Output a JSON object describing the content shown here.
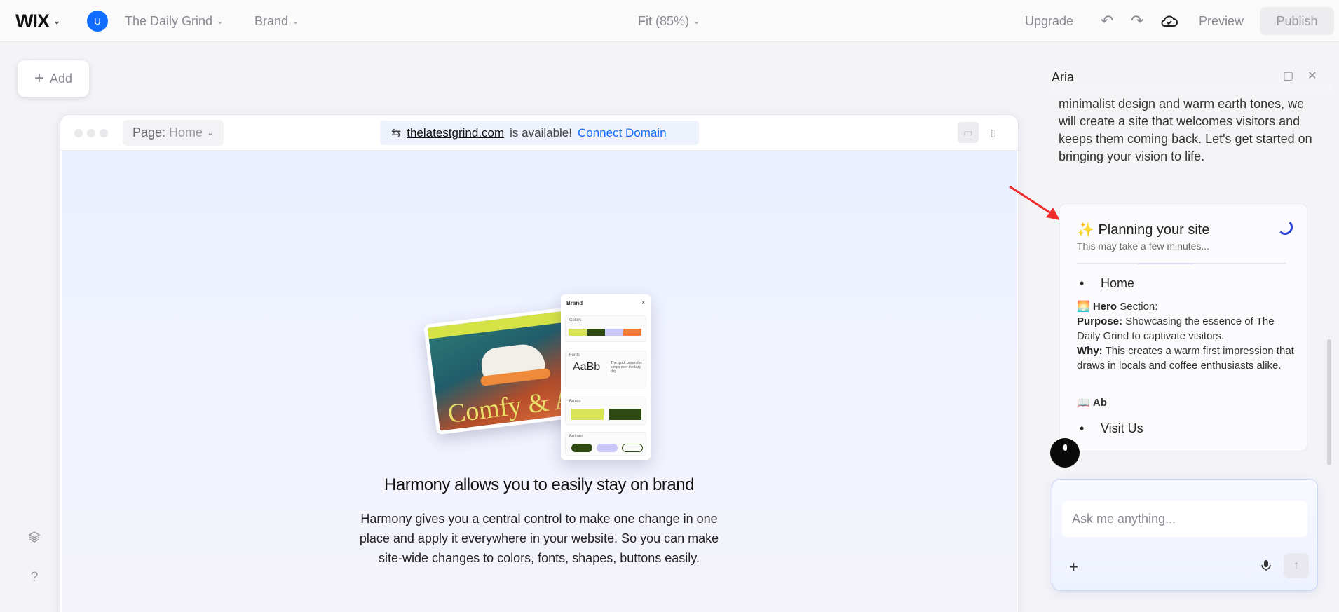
{
  "topbar": {
    "logo": "WIX",
    "avatar_initial": "U",
    "site_name": "The Daily Grind",
    "brand_menu": "Brand",
    "zoom": "Fit (85%)",
    "upgrade": "Upgrade",
    "preview": "Preview",
    "publish": "Publish"
  },
  "add_button": "Add",
  "frame": {
    "page_label": "Page:",
    "page_value": "Home",
    "domain_url": "thelatestgrind.com",
    "domain_status": "is available!",
    "connect_domain": "Connect Domain"
  },
  "canvas": {
    "illustration": {
      "panel_title": "Brand",
      "colors_label": "Colors",
      "fonts_label": "Fonts",
      "fonts_sample": "AaBb",
      "fonts_pangram": "The quick brown fox jumps over the lazy dog",
      "boxes_label": "Boxes",
      "buttons_label": "Buttons",
      "photo_text": "Comfy & A",
      "swatches": [
        "#d8e35a",
        "#2e4a12",
        "#c9c8f8",
        "#ee7d3a"
      ]
    },
    "headline": "Harmony allows you to easily stay on brand",
    "subtext": "Harmony gives you a central control to make one change in one place and apply it  everywhere in your website. So you can make site-wide changes to colors, fonts, shapes, buttons easily."
  },
  "assistant": {
    "title": "Aria",
    "message": "minimalist design and warm earth tones, we will create a site that welcomes visitors and keeps them coming back. Let's get started on bringing your vision to life.",
    "plan": {
      "title_emoji": "✨",
      "title": "Planning your site",
      "subtitle": "This may take a few minutes...",
      "page_home": "Home",
      "hero_emoji": "🌅",
      "hero_label": "Hero",
      "hero_suffix": "Section:",
      "purpose_label": "Purpose:",
      "purpose_text": "Showcasing the essence of The Daily Grind to captivate visitors.",
      "why_label": "Why:",
      "why_text": "This creates a warm first impression that draws in locals and coffee enthusiasts alike.",
      "ab_emoji": "📖",
      "ab_text": "Ab",
      "page_visit": "Visit Us"
    },
    "input_placeholder": "Ask me anything..."
  }
}
